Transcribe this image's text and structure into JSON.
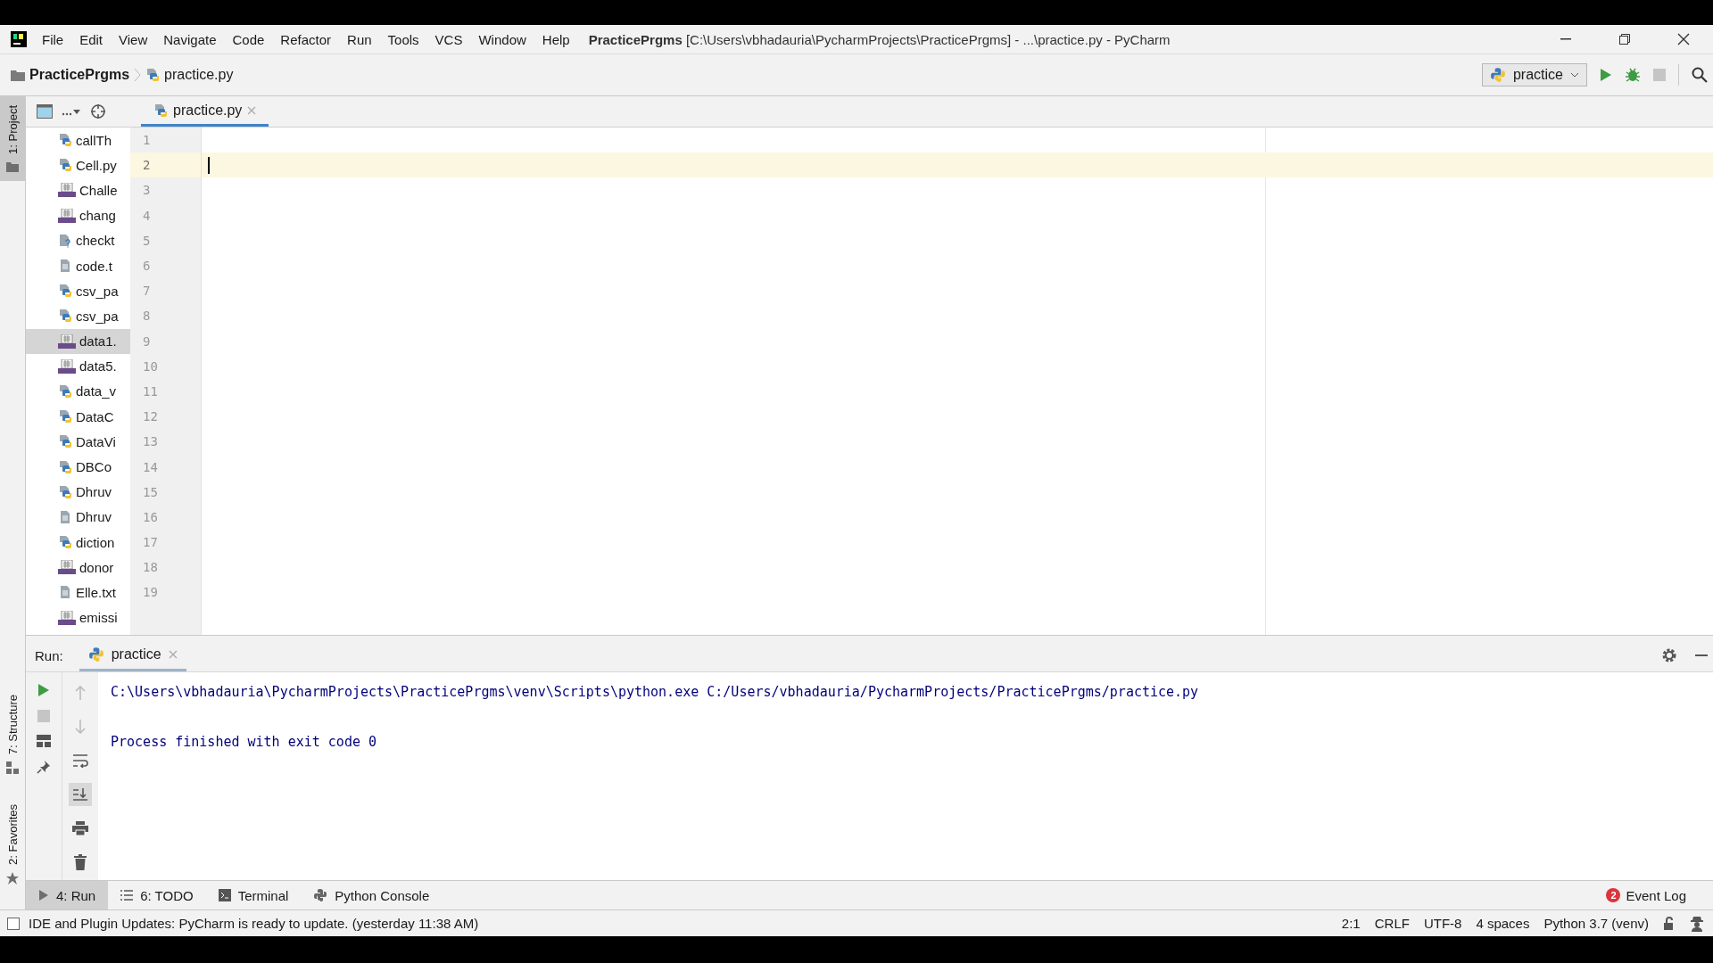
{
  "title_bar": {
    "menu": [
      "File",
      "Edit",
      "View",
      "Navigate",
      "Code",
      "Refactor",
      "Run",
      "Tools",
      "VCS",
      "Window",
      "Help"
    ],
    "title": "**PracticePrgms** [C:\\Users\\vbhadauria\\PycharmProjects\\PracticePrgms] - ...\\practice.py - PyCharm"
  },
  "nav_bar": {
    "breadcrumb": [
      "PracticePrgms",
      "practice.py"
    ],
    "run_config": "practice"
  },
  "left_stripe": [
    {
      "label": "1: Project",
      "kind": "project",
      "selected": true
    },
    {
      "label": "7: Structure",
      "kind": "structure",
      "selected": false
    },
    {
      "label": "2: Favorites",
      "kind": "favorites",
      "selected": false
    }
  ],
  "project_tree": [
    {
      "name": "callTh",
      "kind": "python",
      "selected": false
    },
    {
      "name": "Cell.py",
      "kind": "python",
      "selected": false
    },
    {
      "name": "Challe",
      "kind": "csv",
      "selected": false
    },
    {
      "name": "chang",
      "kind": "csv",
      "selected": false
    },
    {
      "name": "checkt",
      "kind": "unknown",
      "selected": false
    },
    {
      "name": "code.t",
      "kind": "text",
      "selected": false
    },
    {
      "name": "csv_pa",
      "kind": "python",
      "selected": false
    },
    {
      "name": "csv_pa",
      "kind": "python",
      "selected": false
    },
    {
      "name": "data1.",
      "kind": "csv",
      "selected": true
    },
    {
      "name": "data5.",
      "kind": "csv",
      "selected": false
    },
    {
      "name": "data_v",
      "kind": "python",
      "selected": false
    },
    {
      "name": "DataC",
      "kind": "python",
      "selected": false
    },
    {
      "name": "DataVi",
      "kind": "python",
      "selected": false
    },
    {
      "name": "DBCo",
      "kind": "python",
      "selected": false
    },
    {
      "name": "Dhruv",
      "kind": "python",
      "selected": false
    },
    {
      "name": "Dhruv",
      "kind": "text",
      "selected": false
    },
    {
      "name": "diction",
      "kind": "python",
      "selected": false
    },
    {
      "name": "donor",
      "kind": "csv",
      "selected": false
    },
    {
      "name": "Elle.txt",
      "kind": "text",
      "selected": false
    },
    {
      "name": "emissi",
      "kind": "csv",
      "selected": false
    }
  ],
  "editor": {
    "tab": "practice.py",
    "lines": [
      {
        "number": "1",
        "current": false
      },
      {
        "number": "2",
        "current": true
      },
      {
        "number": "3",
        "current": false
      },
      {
        "number": "4",
        "current": false
      },
      {
        "number": "5",
        "current": false
      },
      {
        "number": "6",
        "current": false
      },
      {
        "number": "7",
        "current": false
      },
      {
        "number": "8",
        "current": false
      },
      {
        "number": "9",
        "current": false
      },
      {
        "number": "10",
        "current": false
      },
      {
        "number": "11",
        "current": false
      },
      {
        "number": "12",
        "current": false
      },
      {
        "number": "13",
        "current": false
      },
      {
        "number": "14",
        "current": false
      },
      {
        "number": "15",
        "current": false
      },
      {
        "number": "16",
        "current": false
      },
      {
        "number": "17",
        "current": false
      },
      {
        "number": "18",
        "current": false
      },
      {
        "number": "19",
        "current": false
      }
    ]
  },
  "run_panel": {
    "label": "Run:",
    "tab": "practice",
    "output": [
      {
        "text": "C:\\Users\\vbhadauria\\PycharmProjects\\PracticePrgms\\venv\\Scripts\\python.exe C:/Users/vbhadauria/PycharmProjects/PracticePrgms/practice.py",
        "kind": "command"
      },
      {
        "text": "Process finished with exit code 0",
        "kind": "result"
      }
    ]
  },
  "bottom_tabs": [
    {
      "label": "4: Run",
      "kind": "run",
      "selected": true
    },
    {
      "label": "6: TODO",
      "kind": "todo",
      "selected": false
    },
    {
      "label": "Terminal",
      "kind": "terminal",
      "selected": false
    },
    {
      "label": "Python Console",
      "kind": "console",
      "selected": false
    }
  ],
  "event_log": {
    "count": "2",
    "label": "Event Log"
  },
  "status_bar": {
    "message": "IDE and Plugin Updates: PyCharm is ready to update. (yesterday 11:38 AM)",
    "items": [
      "2:1",
      "CRLF",
      "UTF-8",
      "4 spaces",
      "Python 3.7 (venv)"
    ]
  }
}
